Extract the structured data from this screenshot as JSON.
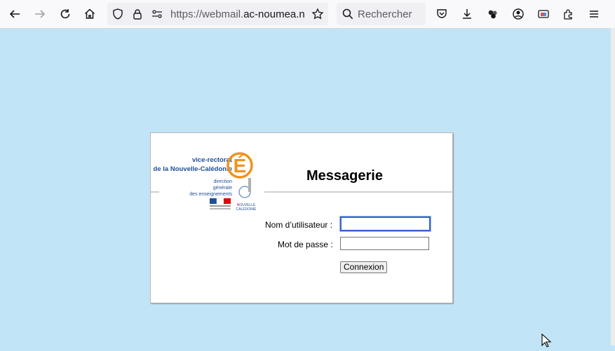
{
  "browser": {
    "url_prefix": "https://webmail.",
    "url_domain": "ac-noumea.nc",
    "url_suffix": "/",
    "search_placeholder": "Rechercher"
  },
  "login": {
    "title": "Messagerie",
    "username_label": "Nom d’utilisateur :",
    "password_label": "Mot de passe :",
    "username_value": "",
    "password_value": "",
    "submit_label": "Connexion"
  },
  "logo": {
    "line1": "vice-rectorat",
    "line2": "de la Nouvelle-Calédonie",
    "line3": "direction",
    "line4": "générale",
    "line5": "des enseignements",
    "big_letter": "É",
    "province": "NOUVELLE",
    "province2": "CALÉDONIE"
  },
  "colors": {
    "page_bg": "#c1e5f7",
    "accent_orange": "#f0931e",
    "logo_blue": "#1f4e96"
  }
}
